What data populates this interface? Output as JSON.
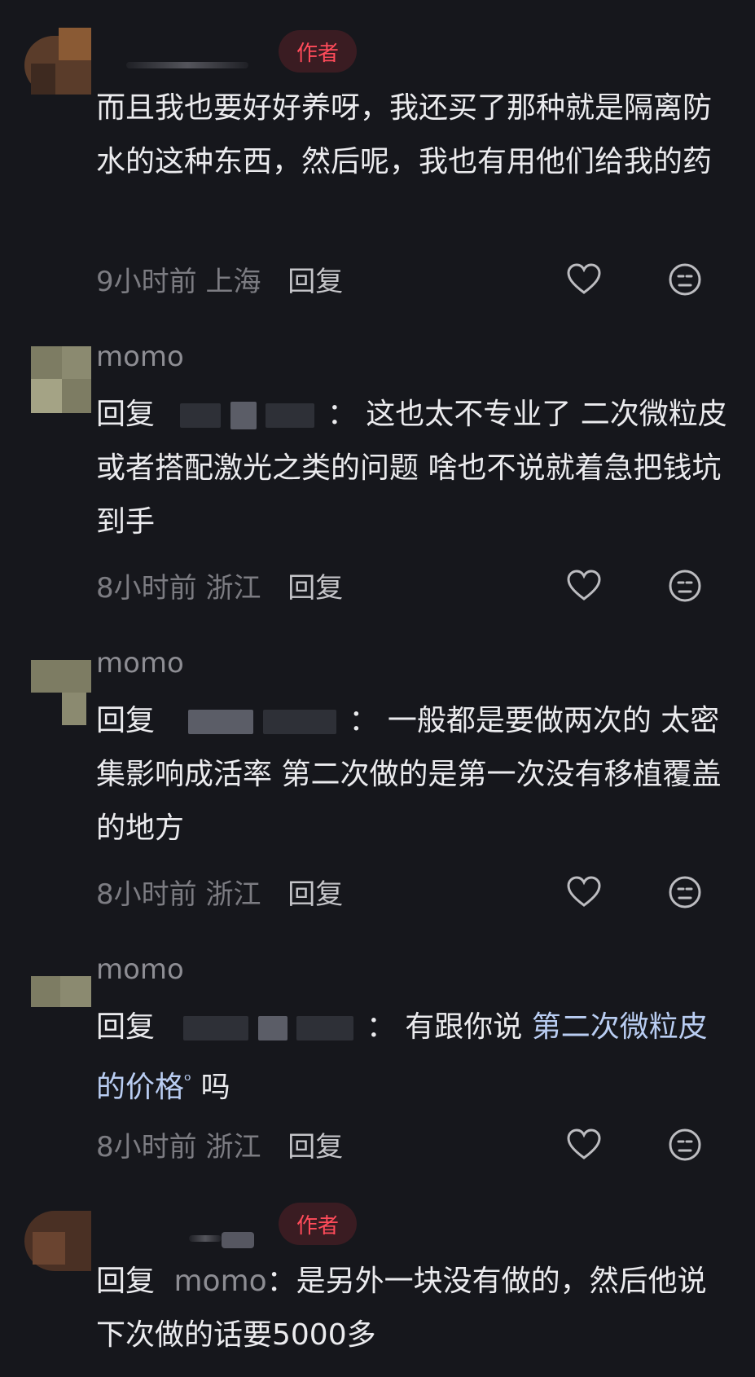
{
  "labels": {
    "author": "作者",
    "reply": "回复",
    "reply_prefix": "回复",
    "colon": "："
  },
  "comments": [
    {
      "name": "",
      "is_author": true,
      "body": "而且我也要好好养呀，我还买了那种就是隔离防水的这种东西，然后呢，我也有用他们给我的药",
      "time": "9小时前",
      "location": "上海"
    },
    {
      "name": "momo",
      "is_author": false,
      "body_after": "这也太不专业了  二次微粒皮或者搭配激光之类的问题 啥也不说就着急把钱坑到手",
      "time": "8小时前",
      "location": "浙江"
    },
    {
      "name": "momo",
      "is_author": false,
      "body_after": "一般都是要做两次的 太密集影响成活率  第二次做的是第一次没有移植覆盖的地方",
      "time": "8小时前",
      "location": "浙江"
    },
    {
      "name": "momo",
      "is_author": false,
      "body_before_link": "有跟你说 ",
      "link": "第二次微粒皮的价格",
      "body_after_link": "吗",
      "search_mark": "ᵒ",
      "time": "8小时前",
      "location": "浙江"
    },
    {
      "name": "",
      "is_author": true,
      "mention": "momo",
      "body_after": "是另外一块没有做的，然后他说下次做的话要5000多"
    }
  ],
  "colors": {
    "background": "#16171c",
    "author_badge_bg": "#3a1c22",
    "author_badge_text": "#ff4b5a",
    "link": "#b9cdf2"
  }
}
